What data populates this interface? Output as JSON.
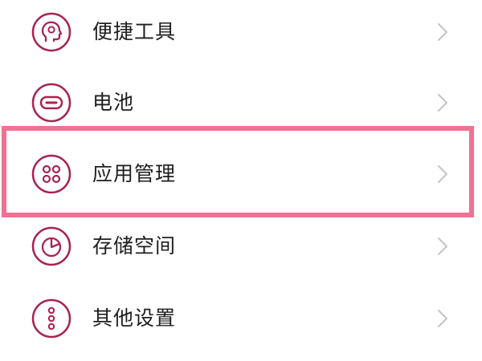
{
  "theme": {
    "accent_color": "#a8244f",
    "highlight_color": "#f07193",
    "text_color": "#1e1e1e",
    "chevron_color": "#c4c4c4"
  },
  "settings": {
    "items": [
      {
        "label": "便捷工具",
        "icon": "head-gear-icon",
        "highlighted": false
      },
      {
        "label": "电池",
        "icon": "battery-icon",
        "highlighted": false
      },
      {
        "label": "应用管理",
        "icon": "app-grid-icon",
        "highlighted": true
      },
      {
        "label": "存储空间",
        "icon": "pie-chart-icon",
        "highlighted": false
      },
      {
        "label": "其他设置",
        "icon": "more-dots-icon",
        "highlighted": false
      }
    ]
  }
}
